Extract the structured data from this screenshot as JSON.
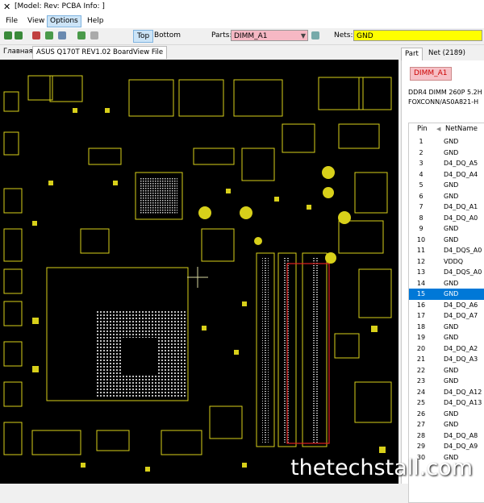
{
  "window": {
    "title": "[Model: Rev:  PCBA Info: ]"
  },
  "menu": [
    "File",
    "View",
    "Options",
    "Help"
  ],
  "toolbar": {
    "top_label": "Top",
    "bottom_label": "Bottom",
    "parts_label": "Parts:",
    "parts_value": "DIMM_A1",
    "nets_label": "Nets:",
    "nets_value": "GND"
  },
  "tabs": [
    "Главная",
    "ASUS Q170T REV1.02 BoardView File"
  ],
  "right_tabs": [
    "Part",
    "Net (2189)"
  ],
  "part": {
    "name": "DIMM_A1",
    "desc1": "DDR4 DIMM 260P 5.2H",
    "desc2": "FOXCONN/AS0A821-H"
  },
  "grid": {
    "headers": [
      "Pin",
      "NetName"
    ],
    "rows": [
      {
        "pin": "1",
        "net": "GND"
      },
      {
        "pin": "2",
        "net": "GND"
      },
      {
        "pin": "3",
        "net": "D4_DQ_A5"
      },
      {
        "pin": "4",
        "net": "D4_DQ_A4"
      },
      {
        "pin": "5",
        "net": "GND"
      },
      {
        "pin": "6",
        "net": "GND"
      },
      {
        "pin": "7",
        "net": "D4_DQ_A1"
      },
      {
        "pin": "8",
        "net": "D4_DQ_A0"
      },
      {
        "pin": "9",
        "net": "GND"
      },
      {
        "pin": "10",
        "net": "GND"
      },
      {
        "pin": "11",
        "net": "D4_DQS_A0"
      },
      {
        "pin": "12",
        "net": "VDDQ"
      },
      {
        "pin": "13",
        "net": "D4_DQS_A0"
      },
      {
        "pin": "14",
        "net": "GND"
      },
      {
        "pin": "15",
        "net": "GND"
      },
      {
        "pin": "16",
        "net": "D4_DQ_A6"
      },
      {
        "pin": "17",
        "net": "D4_DQ_A7"
      },
      {
        "pin": "18",
        "net": "GND"
      },
      {
        "pin": "19",
        "net": "GND"
      },
      {
        "pin": "20",
        "net": "D4_DQ_A2"
      },
      {
        "pin": "21",
        "net": "D4_DQ_A3"
      },
      {
        "pin": "22",
        "net": "GND"
      },
      {
        "pin": "23",
        "net": "GND"
      },
      {
        "pin": "24",
        "net": "D4_DQ_A12"
      },
      {
        "pin": "25",
        "net": "D4_DQ_A13"
      },
      {
        "pin": "26",
        "net": "GND"
      },
      {
        "pin": "27",
        "net": "GND"
      },
      {
        "pin": "28",
        "net": "D4_DQ_A8"
      },
      {
        "pin": "29",
        "net": "D4_DQ_A9"
      },
      {
        "pin": "30",
        "net": "GND"
      }
    ],
    "selected_pin": "15"
  },
  "watermark": "thetechstall.com",
  "colors": {
    "board_bg": "#000000",
    "trace": "#d8d01a",
    "selected_row": "#0078d7",
    "nets_field": "#ffff00",
    "parts_field": "#f6b8c4"
  }
}
